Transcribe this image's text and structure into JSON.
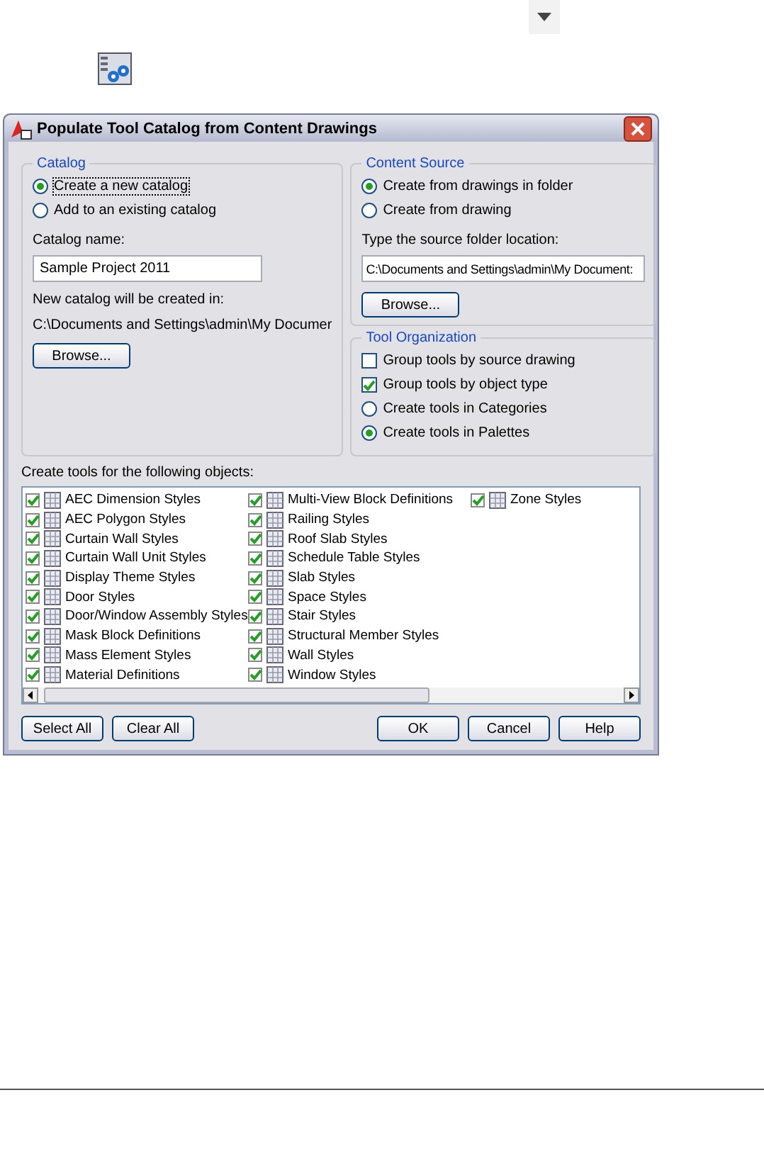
{
  "dialog": {
    "title": "Populate Tool Catalog from Content Drawings"
  },
  "catalog": {
    "title": "Catalog",
    "options": [
      {
        "label": "Create a new catalog",
        "selected": true,
        "focused": true
      },
      {
        "label": "Add to an existing catalog",
        "selected": false,
        "focused": false
      }
    ],
    "name_label": "Catalog name:",
    "name_value": "Sample Project 2011",
    "location_label": "New catalog will be created in:",
    "location_path": "C:\\Documents and Settings\\admin\\My Documer",
    "browse": "Browse..."
  },
  "content_source": {
    "title": "Content Source",
    "options": [
      {
        "label": "Create from drawings in folder",
        "selected": true
      },
      {
        "label": "Create from drawing",
        "selected": false
      }
    ],
    "folder_label": "Type the source folder location:",
    "folder_value": "C:\\Documents and Settings\\admin\\My Document:",
    "browse": "Browse..."
  },
  "tool_organization": {
    "title": "Tool Organization",
    "checks": [
      {
        "label": "Group tools by source drawing",
        "checked": false
      },
      {
        "label": "Group tools by object type",
        "checked": true
      }
    ],
    "options": [
      {
        "label": "Create tools in Categories",
        "selected": false
      },
      {
        "label": "Create tools in Palettes",
        "selected": true
      }
    ]
  },
  "objects": {
    "label": "Create tools for the following objects:",
    "columns": [
      {
        "items": [
          {
            "label": "AEC Dimension Styles",
            "checked": true
          },
          {
            "label": "AEC Polygon Styles",
            "checked": true
          },
          {
            "label": "Curtain Wall Styles",
            "checked": true
          },
          {
            "label": "Curtain Wall Unit Styles",
            "checked": true
          },
          {
            "label": "Display Theme Styles",
            "checked": true
          },
          {
            "label": "Door Styles",
            "checked": true
          },
          {
            "label": "Door/Window Assembly Styles",
            "checked": true
          },
          {
            "label": "Mask Block Definitions",
            "checked": true
          },
          {
            "label": "Mass Element Styles",
            "checked": true
          },
          {
            "label": "Material Definitions",
            "checked": true
          }
        ]
      },
      {
        "items": [
          {
            "label": "Multi-View Block Definitions",
            "checked": true
          },
          {
            "label": "Railing Styles",
            "checked": true
          },
          {
            "label": "Roof Slab Styles",
            "checked": true
          },
          {
            "label": "Schedule Table Styles",
            "checked": true
          },
          {
            "label": "Slab Styles",
            "checked": true
          },
          {
            "label": "Space Styles",
            "checked": true
          },
          {
            "label": "Stair Styles",
            "checked": true
          },
          {
            "label": "Structural Member Styles",
            "checked": true
          },
          {
            "label": "Wall Styles",
            "checked": true
          },
          {
            "label": "Window Styles",
            "checked": true
          }
        ]
      },
      {
        "items": [
          {
            "label": "Zone Styles",
            "checked": true
          }
        ]
      }
    ]
  },
  "buttons_left": [
    "Select All",
    "Clear All"
  ],
  "buttons_right": [
    "OK",
    "Cancel",
    "Help"
  ]
}
